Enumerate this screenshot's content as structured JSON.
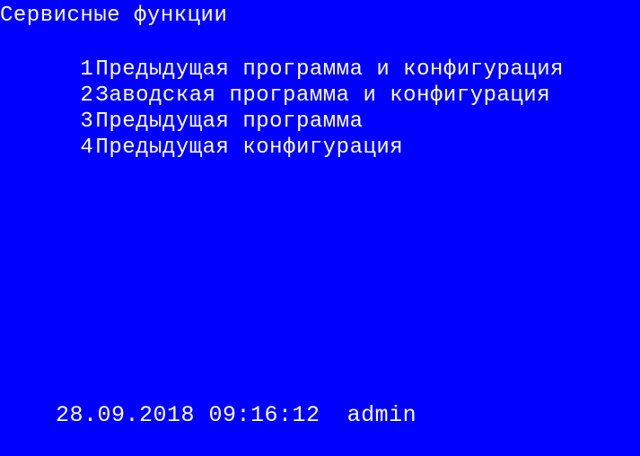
{
  "screen": {
    "title": "Сервисные функции",
    "menu": [
      {
        "key": "1",
        "label": "Предыдущая программа и конфигурация"
      },
      {
        "key": "2",
        "label": "Заводская программа и конфигурация"
      },
      {
        "key": "3",
        "label": "Предыдущая программа"
      },
      {
        "key": "4",
        "label": "Предыдущая конфигурация"
      }
    ]
  },
  "status_bar": {
    "datetime": "28.09.2018 09:16:12",
    "user": "admin"
  },
  "colors": {
    "background": "#0000FF",
    "text": "#FFFFFF"
  }
}
